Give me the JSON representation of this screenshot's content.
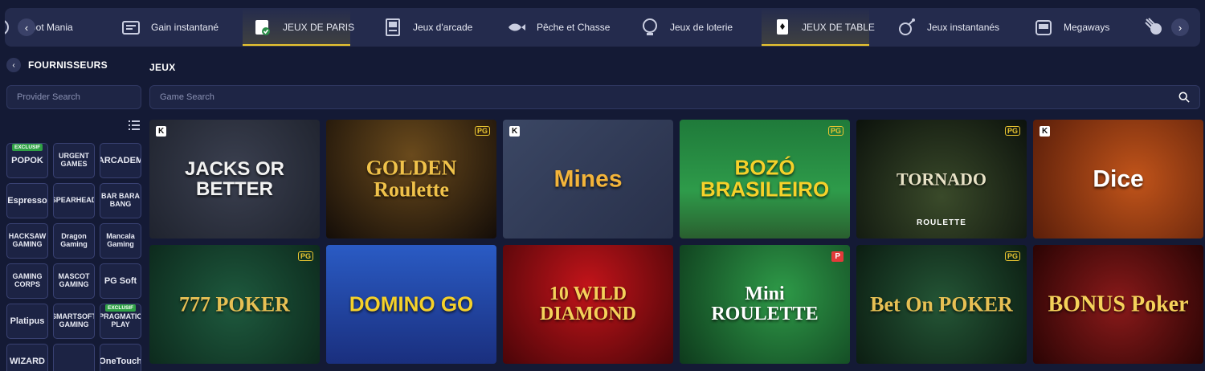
{
  "categories": [
    {
      "label": "ckpot Mania",
      "icon": "jackpot-icon",
      "active": false
    },
    {
      "label": "Gain instantané",
      "icon": "scratch-card-icon",
      "active": false
    },
    {
      "label": "JEUX DE PARIS",
      "icon": "betting-card-icon",
      "active": true
    },
    {
      "label": "Jeux d'arcade",
      "icon": "arcade-machine-icon",
      "active": false
    },
    {
      "label": "Pêche et Chasse",
      "icon": "fish-icon",
      "active": false
    },
    {
      "label": "Jeux de loterie",
      "icon": "lottery-globe-icon",
      "active": false
    },
    {
      "label": "JEUX DE TABLE",
      "icon": "playing-cards-icon",
      "active": true
    },
    {
      "label": "Jeux instantanés",
      "icon": "bomb-icon",
      "active": false
    },
    {
      "label": "Megaways",
      "icon": "slot-machine-icon",
      "active": false
    },
    {
      "label": "",
      "icon": "meteor-icon",
      "active": false
    }
  ],
  "nav": {
    "prev": "‹",
    "next": "›"
  },
  "sidebar": {
    "back": "‹",
    "title": "FOURNISSEURS",
    "search_placeholder": "Provider Search",
    "providers": [
      {
        "label": "POPOK",
        "badge": "EXCLUSIF"
      },
      {
        "label": "URGENT GAMES",
        "badge": ""
      },
      {
        "label": "ARCADEM",
        "badge": ""
      },
      {
        "label": "Espresso",
        "badge": ""
      },
      {
        "label": "SPEARHEAD",
        "badge": ""
      },
      {
        "label": "BAR BARA BANG",
        "badge": ""
      },
      {
        "label": "HACKSAW GAMING",
        "badge": ""
      },
      {
        "label": "Dragon Gaming",
        "badge": ""
      },
      {
        "label": "Mancala Gaming",
        "badge": ""
      },
      {
        "label": "GAMING CORPS",
        "badge": ""
      },
      {
        "label": "MASCOT GAMING",
        "badge": ""
      },
      {
        "label": "PG Soft",
        "badge": ""
      },
      {
        "label": "Platipus",
        "badge": ""
      },
      {
        "label": "SMARTSOFT GAMING",
        "badge": ""
      },
      {
        "label": "PRAGMATIC PLAY",
        "badge": "EXCLUSIF"
      },
      {
        "label": "WIZARD",
        "badge": ""
      },
      {
        "label": "",
        "badge": ""
      },
      {
        "label": "OneTouch",
        "badge": ""
      }
    ]
  },
  "main": {
    "title": "JEUX",
    "search_placeholder": "Game Search",
    "games": [
      {
        "name": "JACKS OR BETTER",
        "provider": "K"
      },
      {
        "name": "GOLDEN Roulette",
        "provider": "PG"
      },
      {
        "name": "Mines",
        "provider": "K"
      },
      {
        "name": "BOZÓ BRASILEIRO",
        "provider": "PG"
      },
      {
        "name": "TORNADO",
        "sub": "ROULETTE",
        "provider": "PG"
      },
      {
        "name": "Dice",
        "provider": "K"
      },
      {
        "name": "777 POKER",
        "provider": "PG"
      },
      {
        "name": "DOMINO GO",
        "provider": ""
      },
      {
        "name": "10 WILD DIAMOND",
        "provider": ""
      },
      {
        "name": "Mini ROULETTE",
        "provider": "P"
      },
      {
        "name": "Bet On POKER",
        "provider": "PG"
      },
      {
        "name": "BONUS Poker",
        "provider": ""
      }
    ]
  },
  "colors": {
    "accent": "#e9c531",
    "bg": "#141a35",
    "bar": "#242b4d"
  }
}
